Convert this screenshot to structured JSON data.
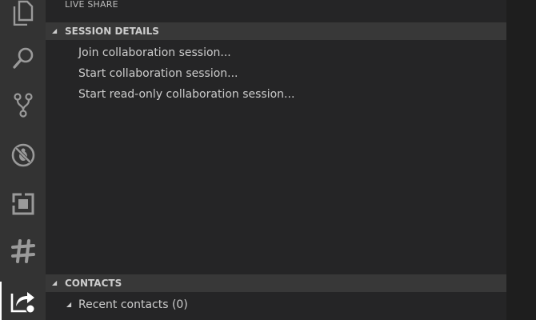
{
  "activity_bar": {
    "items": [
      {
        "icon": "files-icon"
      },
      {
        "icon": "search-icon"
      },
      {
        "icon": "source-control-icon"
      },
      {
        "icon": "debug-icon"
      },
      {
        "icon": "extensions-icon"
      },
      {
        "icon": "slack-icon"
      },
      {
        "icon": "live-share-icon"
      }
    ]
  },
  "sidebar": {
    "title": "LIVE SHARE",
    "session_details": {
      "header": "SESSION DETAILS",
      "items": [
        "Join collaboration session...",
        "Start collaboration session...",
        "Start read-only collaboration session..."
      ]
    },
    "contacts": {
      "header": "CONTACTS",
      "items": [
        "Recent contacts (0)"
      ]
    }
  },
  "colors": {
    "activity_bar": "#333333",
    "sidebar": "#252526",
    "section_header": "#383838",
    "editor": "#1e1e1e"
  }
}
